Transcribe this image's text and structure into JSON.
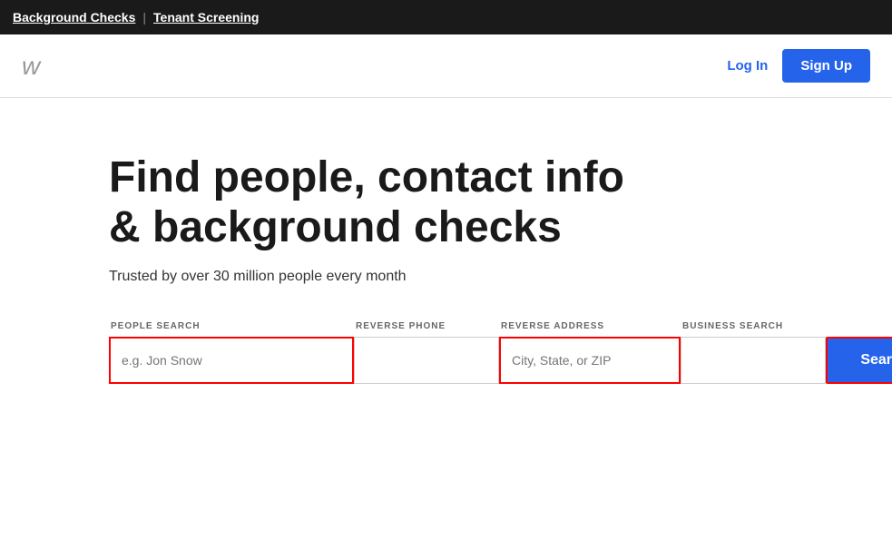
{
  "topbar": {
    "link1": "Background Checks",
    "divider": "|",
    "link2": "Tenant Screening"
  },
  "header": {
    "logo": "w",
    "login_label": "Log In",
    "signup_label": "Sign Up"
  },
  "main": {
    "headline": "Find people, contact info & background checks",
    "subtext": "Trusted by over 30 million people every month",
    "tabs": [
      {
        "label": "PEOPLE SEARCH",
        "active": true
      },
      {
        "label": "REVERSE PHONE",
        "active": false
      },
      {
        "label": "REVERSE ADDRESS",
        "active": false
      },
      {
        "label": "BUSINESS SEARCH",
        "active": false
      }
    ],
    "name_input_placeholder": "e.g. Jon Snow",
    "phone_input_placeholder": "",
    "location_input_placeholder": "City, State, or ZIP",
    "business_input_placeholder": "",
    "search_button_label": "Search"
  }
}
